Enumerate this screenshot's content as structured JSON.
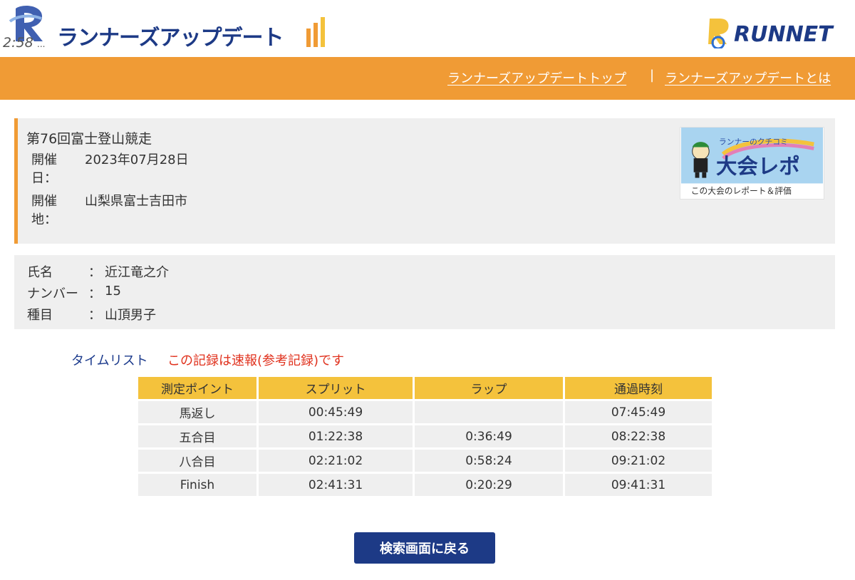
{
  "header": {
    "logo_clock": "2:58",
    "logo_text": "ランナーズアップデート",
    "partner_logo": "RUNNET"
  },
  "nav": {
    "links": [
      "ランナーズアップデートトップ",
      "ランナーズアップデートとは"
    ],
    "separator": "|"
  },
  "event": {
    "title": "第76回富士登山競走",
    "date_label": "開催日：",
    "date_value": "2023年07月28日",
    "place_label": "開催地：",
    "place_value": "山梨県富士吉田市"
  },
  "report_banner": {
    "heading": "ランナーのクチコミ",
    "big_text": "大会レポ",
    "caption": "この大会のレポート＆評価",
    "icon": "runner-character-icon"
  },
  "runner": {
    "name_label": "氏名",
    "name_value": "近江竜之介",
    "number_label": "ナンバー",
    "number_value": "15",
    "category_label": "種目",
    "category_value": "山頂男子",
    "colon": "："
  },
  "timelist": {
    "heading": "タイムリスト",
    "note": "この記録は速報(参考記録)です",
    "columns": [
      "測定ポイント",
      "スプリット",
      "ラップ",
      "通過時刻"
    ],
    "rows": [
      [
        "馬返し",
        "00:45:49",
        "",
        "07:45:49"
      ],
      [
        "五合目",
        "01:22:38",
        "0:36:49",
        "08:22:38"
      ],
      [
        "八合目",
        "02:21:02",
        "0:58:24",
        "09:21:02"
      ],
      [
        "Finish",
        "02:41:31",
        "0:20:29",
        "09:41:31"
      ]
    ]
  },
  "back_button": "検索画面に戻る",
  "colors": {
    "orange": "#f09b35",
    "navy": "#1d3a86",
    "table_header": "#f4c23c",
    "alert_red": "#e0321e",
    "panel_gray": "#efefef"
  }
}
